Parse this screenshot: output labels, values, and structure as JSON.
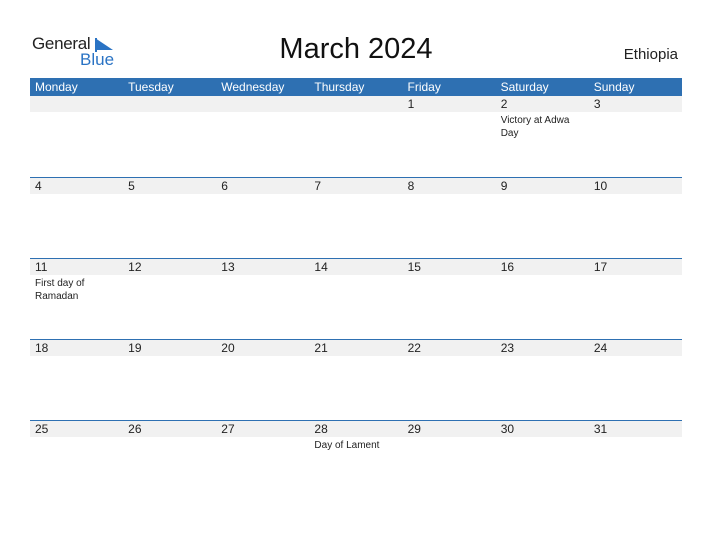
{
  "logo": {
    "line1": "General",
    "line2": "Blue"
  },
  "title": "March 2024",
  "country": "Ethiopia",
  "colors": {
    "accent": "#2e70b2",
    "date_strip": "#f1f1f1"
  },
  "weekdays": [
    "Monday",
    "Tuesday",
    "Wednesday",
    "Thursday",
    "Friday",
    "Saturday",
    "Sunday"
  ],
  "weeks": [
    [
      {
        "d": ""
      },
      {
        "d": ""
      },
      {
        "d": ""
      },
      {
        "d": ""
      },
      {
        "d": "1"
      },
      {
        "d": "2",
        "event": "Victory at Adwa Day"
      },
      {
        "d": "3"
      }
    ],
    [
      {
        "d": "4"
      },
      {
        "d": "5"
      },
      {
        "d": "6"
      },
      {
        "d": "7"
      },
      {
        "d": "8"
      },
      {
        "d": "9"
      },
      {
        "d": "10"
      }
    ],
    [
      {
        "d": "11",
        "event": "First day of Ramadan"
      },
      {
        "d": "12"
      },
      {
        "d": "13"
      },
      {
        "d": "14"
      },
      {
        "d": "15"
      },
      {
        "d": "16"
      },
      {
        "d": "17"
      }
    ],
    [
      {
        "d": "18"
      },
      {
        "d": "19"
      },
      {
        "d": "20"
      },
      {
        "d": "21"
      },
      {
        "d": "22"
      },
      {
        "d": "23"
      },
      {
        "d": "24"
      }
    ],
    [
      {
        "d": "25"
      },
      {
        "d": "26"
      },
      {
        "d": "27"
      },
      {
        "d": "28",
        "event": "Day of Lament"
      },
      {
        "d": "29"
      },
      {
        "d": "30"
      },
      {
        "d": "31"
      }
    ]
  ]
}
